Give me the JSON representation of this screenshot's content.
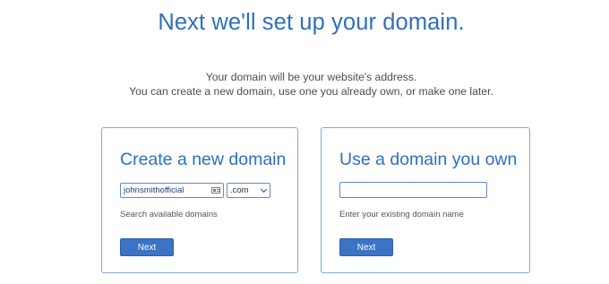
{
  "header": {
    "title": "Next we'll set up your domain.",
    "subtitle_line1": "Your domain will be your website's address.",
    "subtitle_line2": "You can create a new domain, use one you already own, or make one later."
  },
  "create_card": {
    "title": "Create a new domain",
    "domain_value": "johnsmithofficial",
    "tld_selected": ".com",
    "hint": "Search available domains",
    "button_label": "Next"
  },
  "own_card": {
    "title": "Use a domain you own",
    "domain_value": "",
    "hint": "Enter your existing domain name",
    "button_label": "Next"
  },
  "colors": {
    "accent": "#2e6fc1",
    "button": "#3b74c4",
    "card_border": "#7fa8dc"
  }
}
